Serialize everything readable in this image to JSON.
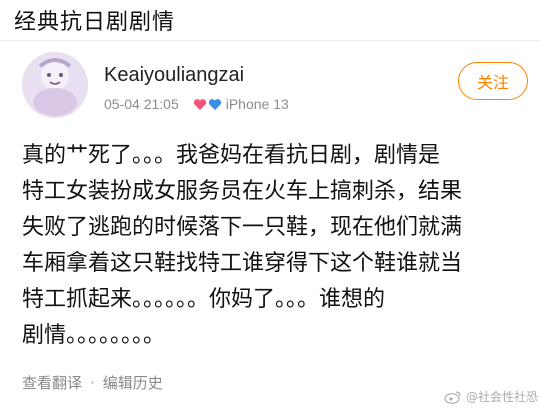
{
  "page_title": "经典抗日剧剧情",
  "post": {
    "username": "Keaiyouliangzai",
    "timestamp": "05-04 21:05",
    "device": "iPhone 13",
    "follow_label": "关注",
    "body_lines": [
      "真的艹死了。。。我爸妈在看抗日剧，剧情是",
      "特工女装扮成女服务员在火车上搞刺杀，结果",
      "失败了逃跑的时候落下一只鞋，现在他们就满",
      "车厢拿着这只鞋找特工谁穿得下这个鞋谁就当",
      "特工抓起来。。。。。。你妈了。。。谁想的",
      "剧情。。。。。。。。"
    ],
    "actions": {
      "translate": "查看翻译",
      "edit_history": "编辑历史"
    }
  },
  "watermark": {
    "text": "@社会性社恐"
  },
  "colors": {
    "accent": "#ff8200",
    "meta_gray": "#8c8c8c",
    "heart_pink": "#f2557a",
    "heart_blue": "#3d8ee8"
  }
}
